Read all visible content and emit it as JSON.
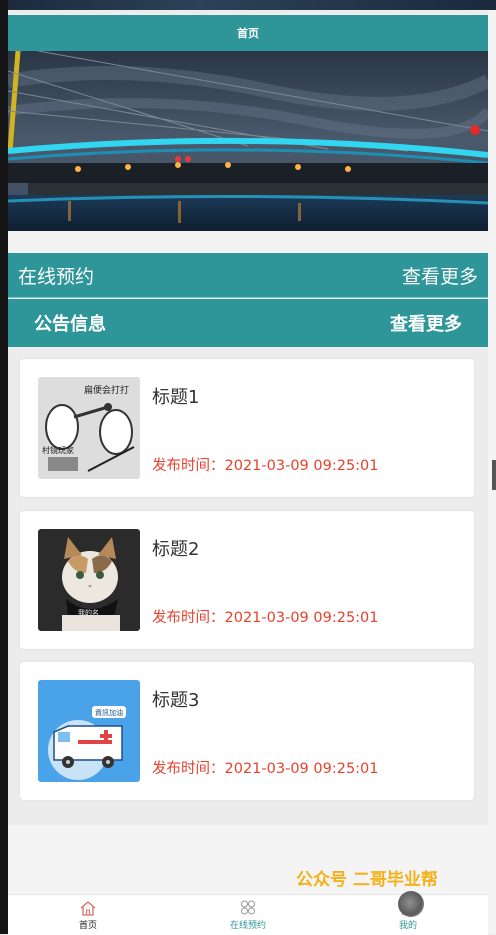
{
  "header": {
    "title": "首页"
  },
  "banner": {
    "image": "night-bridge-photo",
    "indicator_color": "#e02b2b"
  },
  "section_booking": {
    "title": "在线预约",
    "more": "查看更多"
  },
  "section_notice": {
    "title": "公告信息",
    "more": "查看更多"
  },
  "notices": [
    {
      "title": "标题1",
      "time_label": "发布时间：",
      "time": "2021-03-09 09:25:01",
      "thumb": "cartoon-illustration"
    },
    {
      "title": "标题2",
      "time_label": "发布时间：",
      "time": "2021-03-09 09:25:01",
      "thumb": "cat-photo"
    },
    {
      "title": "标题3",
      "time_label": "发布时间：",
      "time": "2021-03-09 09:25:01",
      "thumb": "ambulance-illustration"
    }
  ],
  "watermark": "公众号 二哥毕业帮",
  "tabbar": [
    {
      "label": "首页",
      "icon": "home-icon",
      "active": true
    },
    {
      "label": "在线预约",
      "icon": "grid-icon",
      "active": false
    },
    {
      "label": "我的",
      "icon": "user-icon",
      "active": false
    }
  ],
  "colors": {
    "theme": "#2e9598",
    "time_text": "#e8412c",
    "watermark": "#f3b21b"
  }
}
